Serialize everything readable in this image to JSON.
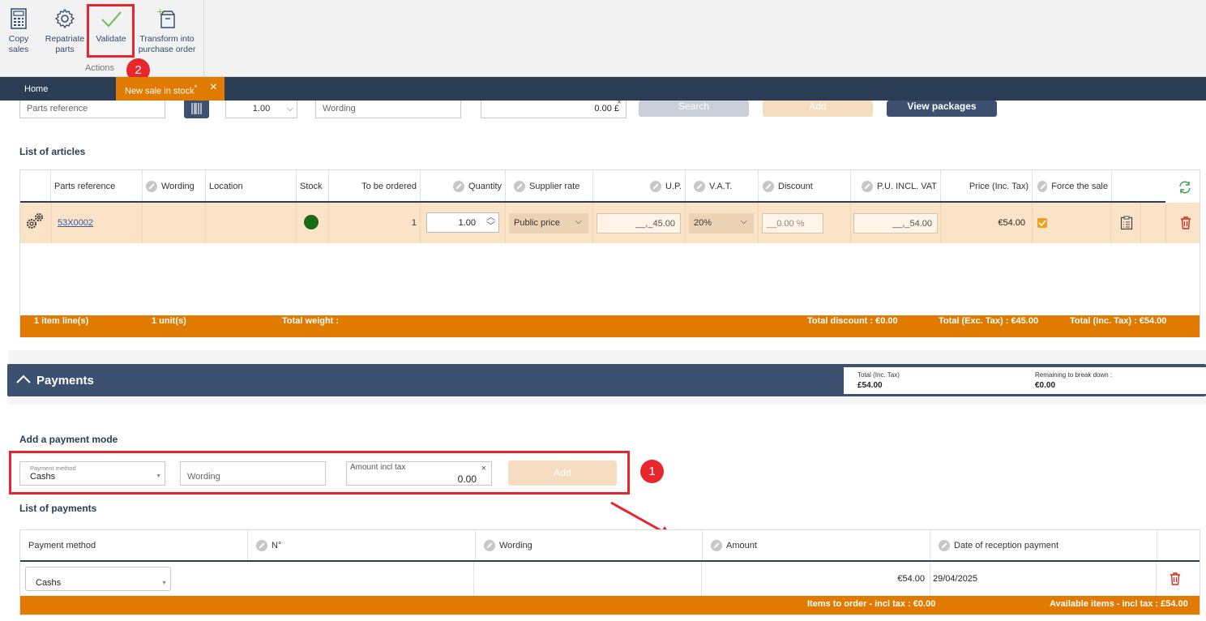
{
  "ribbon": {
    "copy_sales": "Copy\nsales",
    "repatriate_parts": "Repatriate\nparts",
    "validate": "Validate",
    "transform": "Transform into\npurchase order",
    "group_label": "Actions"
  },
  "tabs": {
    "home": "Home",
    "active": "New sale in stock",
    "active_modified_marker": "*"
  },
  "search_row": {
    "parts_reference_placeholder": "Parts reference",
    "quantity_value": "1.00",
    "wording_placeholder": "Wording",
    "price_value": "0.00 £",
    "search_label": "Search",
    "add_label": "Add",
    "view_packages_label": "View packages"
  },
  "articles": {
    "title": "List of articles",
    "headers": {
      "parts_reference": "Parts reference",
      "wording": "Wording",
      "location": "Location",
      "stock": "Stock",
      "to_be_ordered": "To be ordered",
      "quantity": "Quantity",
      "supplier_rate": "Supplier rate",
      "up": "U.P.",
      "vat": "V.A.T.",
      "discount": "Discount",
      "pu_incl_vat": "P.U. INCL. VAT",
      "price_inc_tax": "Price (Inc. Tax)",
      "force_sale": "Force the sale"
    },
    "row": {
      "parts_reference": "53X0002",
      "to_be_ordered": "1",
      "quantity": "1.00",
      "supplier_rate": "Public price",
      "up": "__,_45.00",
      "vat": "20%",
      "discount": "__0.00 %",
      "pu_incl_vat": "__,_54.00",
      "price_inc_tax": "€54.00",
      "stock_color": "#1b6b12",
      "force_sale_checked": true
    },
    "footer": {
      "item_lines": "1 item line(s)",
      "units": "1 unit(s)",
      "total_weight": "Total weight :",
      "total_discount": "Total discount : €0.00",
      "total_exc_tax": "Total (Exc. Tax) : €45.00",
      "total_inc_tax": "Total (Inc. Tax) : €54.00"
    }
  },
  "payments": {
    "title": "Payments",
    "summary": {
      "total_label": "Total (Inc. Tax)",
      "total_value": "£54.00",
      "remaining_label": "Remaining to break down :",
      "remaining_value": "€0.00"
    },
    "add_mode": {
      "title": "Add a payment mode",
      "method_label": "Payment method",
      "method_value": "Cashs",
      "wording_placeholder": "Wording",
      "amount_label": "Amount incl tax",
      "amount_value": "0.00",
      "add_label": "Add"
    },
    "list": {
      "title": "List of payments",
      "headers": {
        "method": "Payment method",
        "number": "N°",
        "wording": "Wording",
        "amount": "Amount",
        "date": "Date of reception payment"
      },
      "row": {
        "method": "Cashs",
        "amount": "€54.00",
        "date": "29/04/2025"
      },
      "footer": {
        "items_to_order": "Items to order - incl tax : €0.00",
        "available_items": "Available items - incl tax : £54.00"
      }
    }
  },
  "annotations": {
    "badge_1": "1",
    "badge_2": "2"
  },
  "colors": {
    "accent": "#e07a00",
    "navy": "#2b3d55",
    "highlight_red": "#e8262d"
  }
}
